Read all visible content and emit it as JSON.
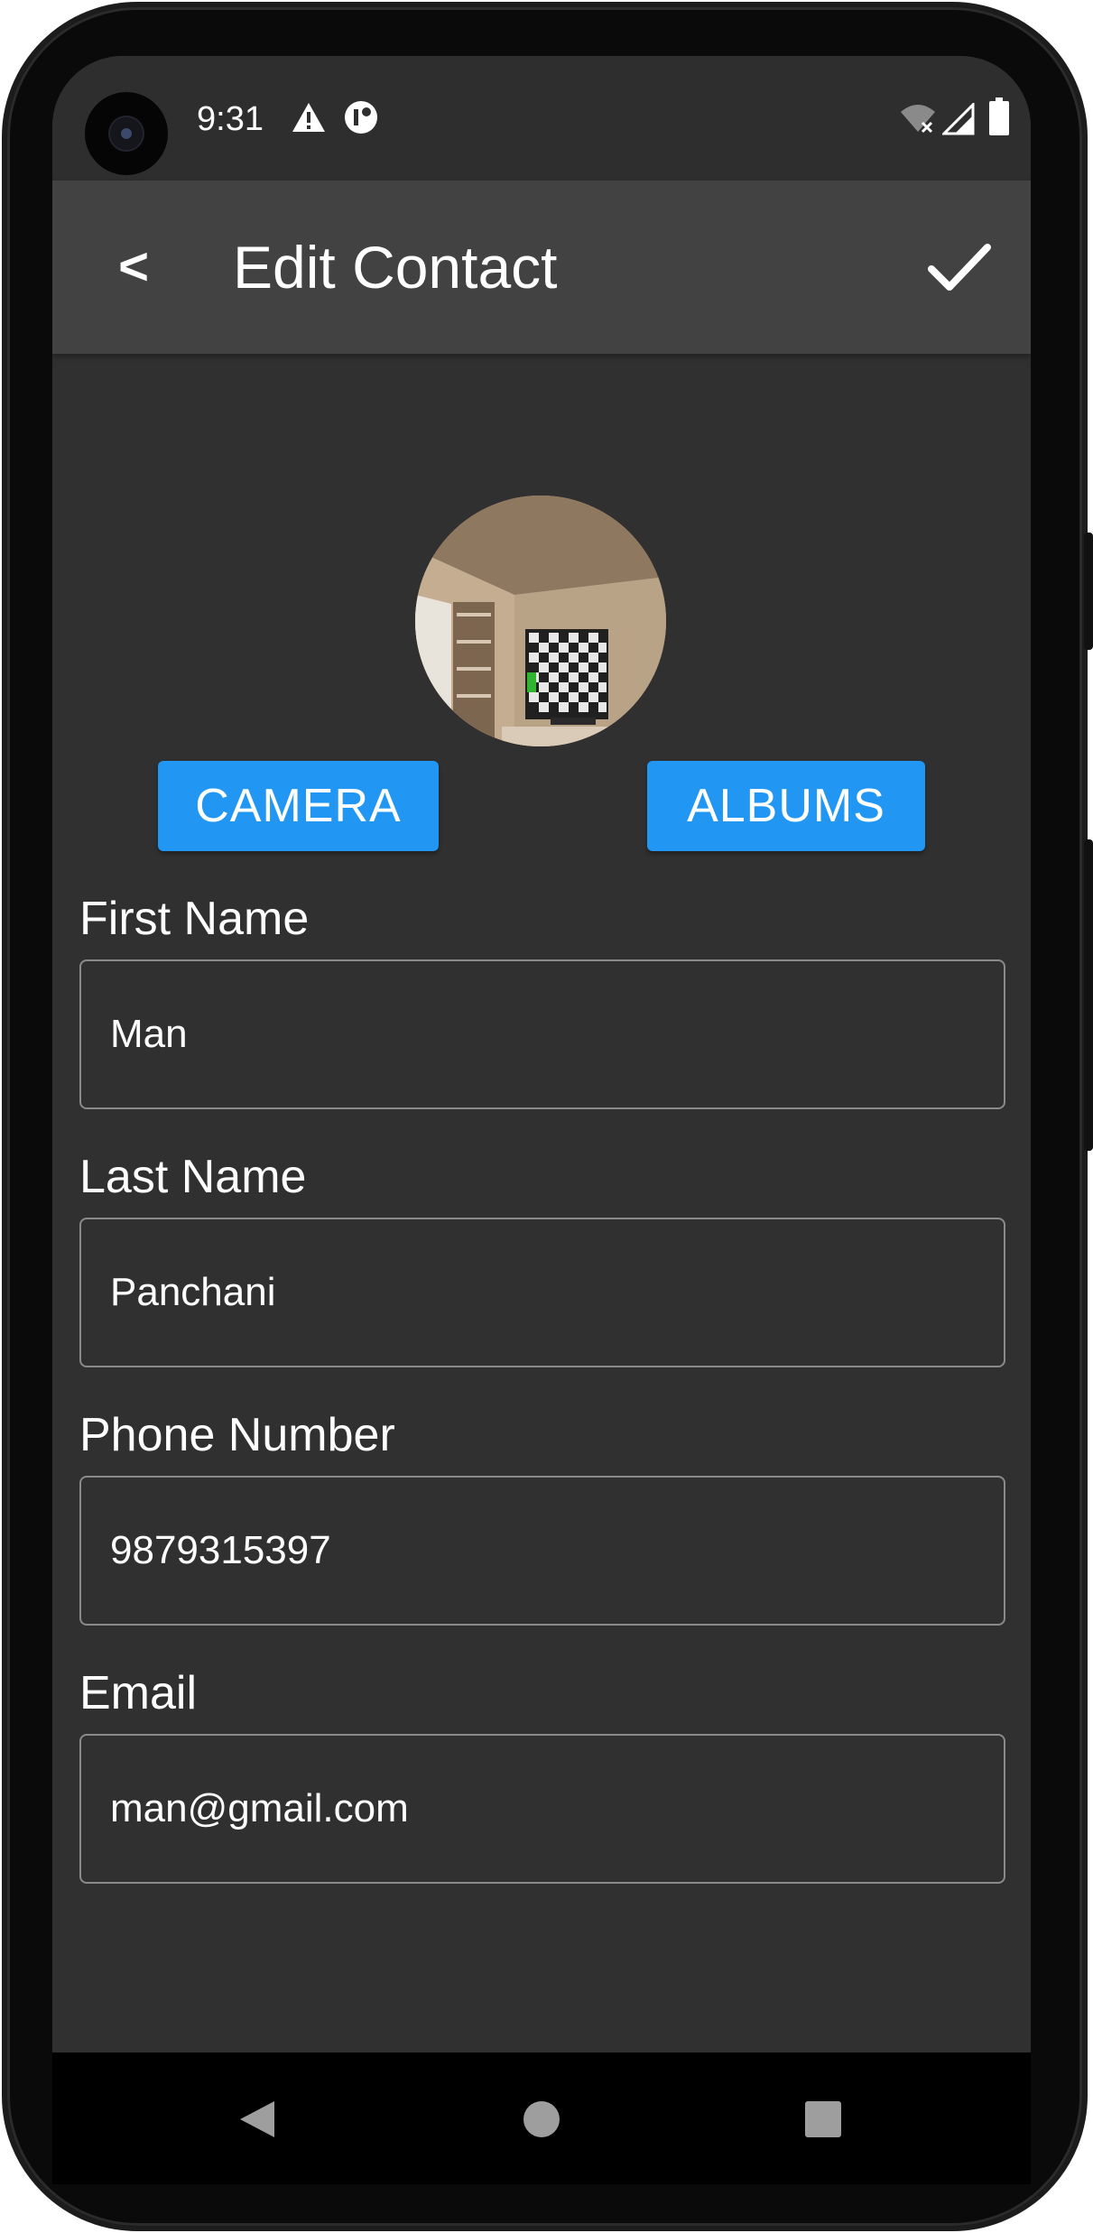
{
  "status_bar": {
    "time": "9:31",
    "icons": [
      "warning-icon",
      "data-saver-icon",
      "wifi-off-icon",
      "signal-icon",
      "battery-icon"
    ]
  },
  "app_bar": {
    "back_label": "<",
    "title": "Edit Contact",
    "save_icon": "check-icon"
  },
  "photo_actions": {
    "camera_label": "CAMERA",
    "albums_label": "ALBUMS"
  },
  "form": {
    "first_name": {
      "label": "First Name",
      "value": "Man"
    },
    "last_name": {
      "label": "Last Name",
      "value": "Panchani"
    },
    "phone": {
      "label": "Phone Number",
      "value": "9879315397"
    },
    "email": {
      "label": "Email",
      "value": "man@gmail.com"
    }
  },
  "nav_bar": {
    "buttons": [
      "back-icon",
      "home-icon",
      "recents-icon"
    ]
  },
  "colors": {
    "screen_bg": "#303030",
    "app_bar_bg": "#424242",
    "accent": "#2196f3"
  }
}
